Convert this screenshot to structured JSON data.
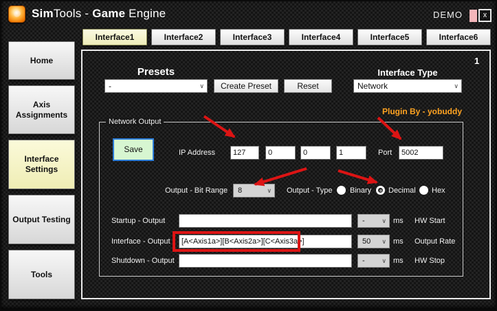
{
  "window": {
    "title": {
      "seg1": "Sim",
      "seg2": "Tools - ",
      "seg3": "Game",
      "seg4": " Engine"
    },
    "demo_label": "DEMO",
    "close_label": "x",
    "page_indicator": "1"
  },
  "tabs": [
    {
      "label": "Interface1",
      "active": true
    },
    {
      "label": "Interface2",
      "active": false
    },
    {
      "label": "Interface3",
      "active": false
    },
    {
      "label": "Interface4",
      "active": false
    },
    {
      "label": "Interface5",
      "active": false
    },
    {
      "label": "Interface6",
      "active": false
    }
  ],
  "sidebar": [
    {
      "label": "Home",
      "active": false
    },
    {
      "label": "Axis Assignments",
      "active": false
    },
    {
      "label": "Interface Settings",
      "active": true
    },
    {
      "label": "Output Testing",
      "active": false
    },
    {
      "label": "Tools",
      "active": false
    }
  ],
  "presets": {
    "label": "Presets",
    "selected": "-",
    "create_button": "Create Preset",
    "reset_button": "Reset"
  },
  "interface_type": {
    "label": "Interface Type",
    "selected": "Network"
  },
  "plugin_credit": "Plugin By - yobuddy",
  "network_output": {
    "group_label": "Network Output",
    "save_button": "Save",
    "ip_label": "IP Address",
    "ip_octets": [
      "127",
      "0",
      "0",
      "1"
    ],
    "port_label": "Port",
    "port_value": "5002",
    "bit_range_label": "Output - Bit Range",
    "bit_range_value": "8",
    "output_type_label": "Output - Type",
    "output_type_options": [
      {
        "label": "Binary",
        "selected": false
      },
      {
        "label": "Decimal",
        "selected": true
      },
      {
        "label": "Hex",
        "selected": false
      }
    ],
    "rows": [
      {
        "label": "Startup - Output",
        "value": "",
        "rate": "-",
        "unit": "ms",
        "tag": "HW Start",
        "highlighted": false
      },
      {
        "label": "Interface - Output",
        "value": "[A<Axis1a>][B<Axis2a>][C<Axis3a>]",
        "rate": "50",
        "unit": "ms",
        "tag": "Output Rate",
        "highlighted": true
      },
      {
        "label": "Shutdown - Output",
        "value": "",
        "rate": "-",
        "unit": "ms",
        "tag": "HW Stop",
        "highlighted": false
      }
    ]
  },
  "annotations": {
    "arrow_color": "#dc1414",
    "highlight_box_target": "interface-output-field"
  },
  "colors": {
    "accent_red": "#dc1414",
    "plugin_orange": "#ffa321",
    "active_tab_yellow": "#f0eebc",
    "save_green": "#d7f6d1",
    "save_border_blue": "#2d7dd9",
    "demo_pink": "#f4b6ba"
  },
  "dropdown_chevron": "∨"
}
